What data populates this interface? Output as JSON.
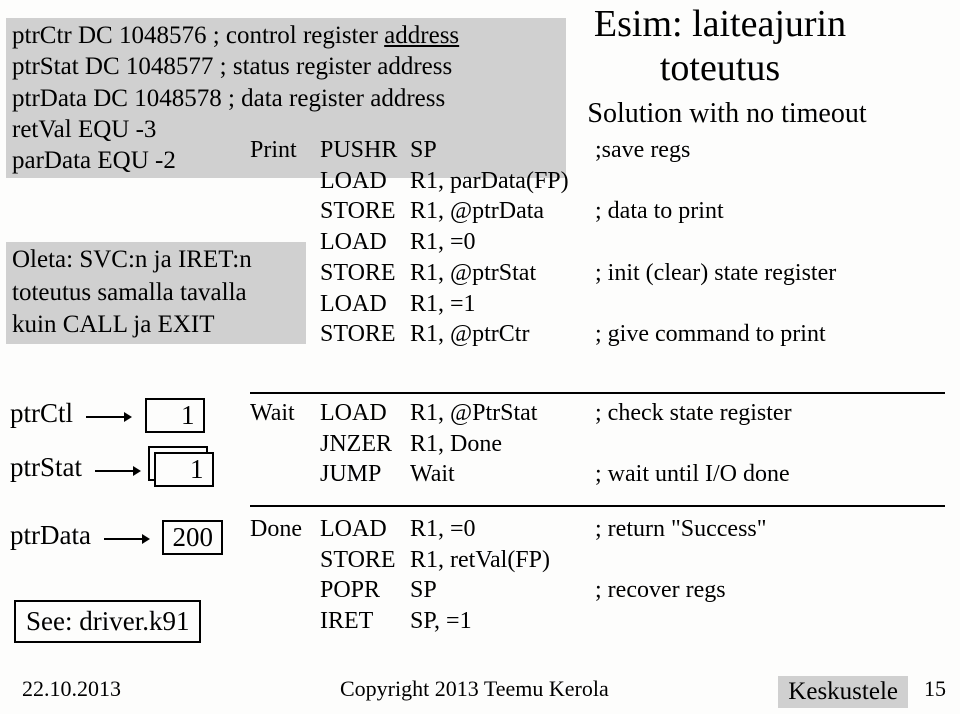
{
  "title_line1": "Esim: laiteajurin",
  "title_line2": "toteutus",
  "subtitle": "Solution with no timeout",
  "defs": {
    "l1a": "ptrCtr    DC  1048576 ; control register ",
    "l1b": "address",
    "l2": "ptrStat   DC  1048577 ; status register address",
    "l3": "ptrData  DC  1048578 ; data register address",
    "l4": "retVal    EQU  -3",
    "l5": "parData  EQU  -2"
  },
  "assume": {
    "l1": "Oleta: SVC:n ja IRET:n",
    "l2": "toteutus samalla tavalla",
    "l3": "kuin CALL ja EXIT"
  },
  "code_main": [
    [
      "Print",
      "PUSHR",
      "SP",
      ";save regs"
    ],
    [
      "",
      "LOAD",
      "R1, parData(FP)",
      ""
    ],
    [
      "",
      "STORE",
      "R1, @ptrData",
      "; data to print"
    ],
    [
      "",
      "LOAD",
      "R1, =0",
      ""
    ],
    [
      "",
      "STORE",
      "R1, @ptrStat",
      "; init (clear) state register"
    ],
    [
      "",
      "LOAD",
      "R1, =1",
      ""
    ],
    [
      "",
      "STORE",
      "R1, @ptrCtr",
      "; give command to print"
    ]
  ],
  "code_wait": [
    [
      "Wait",
      "LOAD",
      "R1, @PtrStat",
      "; check state register"
    ],
    [
      "",
      "JNZER",
      "R1, Done",
      ""
    ],
    [
      "",
      "JUMP",
      "Wait",
      "; wait until I/O done"
    ]
  ],
  "code_done": [
    [
      "Done",
      "LOAD",
      "R1, =0",
      "; return \"Success\""
    ],
    [
      "",
      "STORE",
      "R1, retVal(FP)",
      ""
    ],
    [
      "",
      "POPR",
      "SP",
      "; recover regs"
    ],
    [
      "",
      "IRET",
      "SP, =1",
      ""
    ]
  ],
  "ptrs": {
    "ctl_label": "ptrCtl",
    "ctl_value": "1",
    "stat_label": "ptrStat",
    "stat_value": "1",
    "data_label": "ptrData",
    "data_value": "200"
  },
  "see_driver": "See:  driver.k91",
  "footer": {
    "date": "22.10.2013",
    "copy": "Copyright 2013 Teemu Kerola",
    "discuss": "Keskustele",
    "slide": "15"
  }
}
